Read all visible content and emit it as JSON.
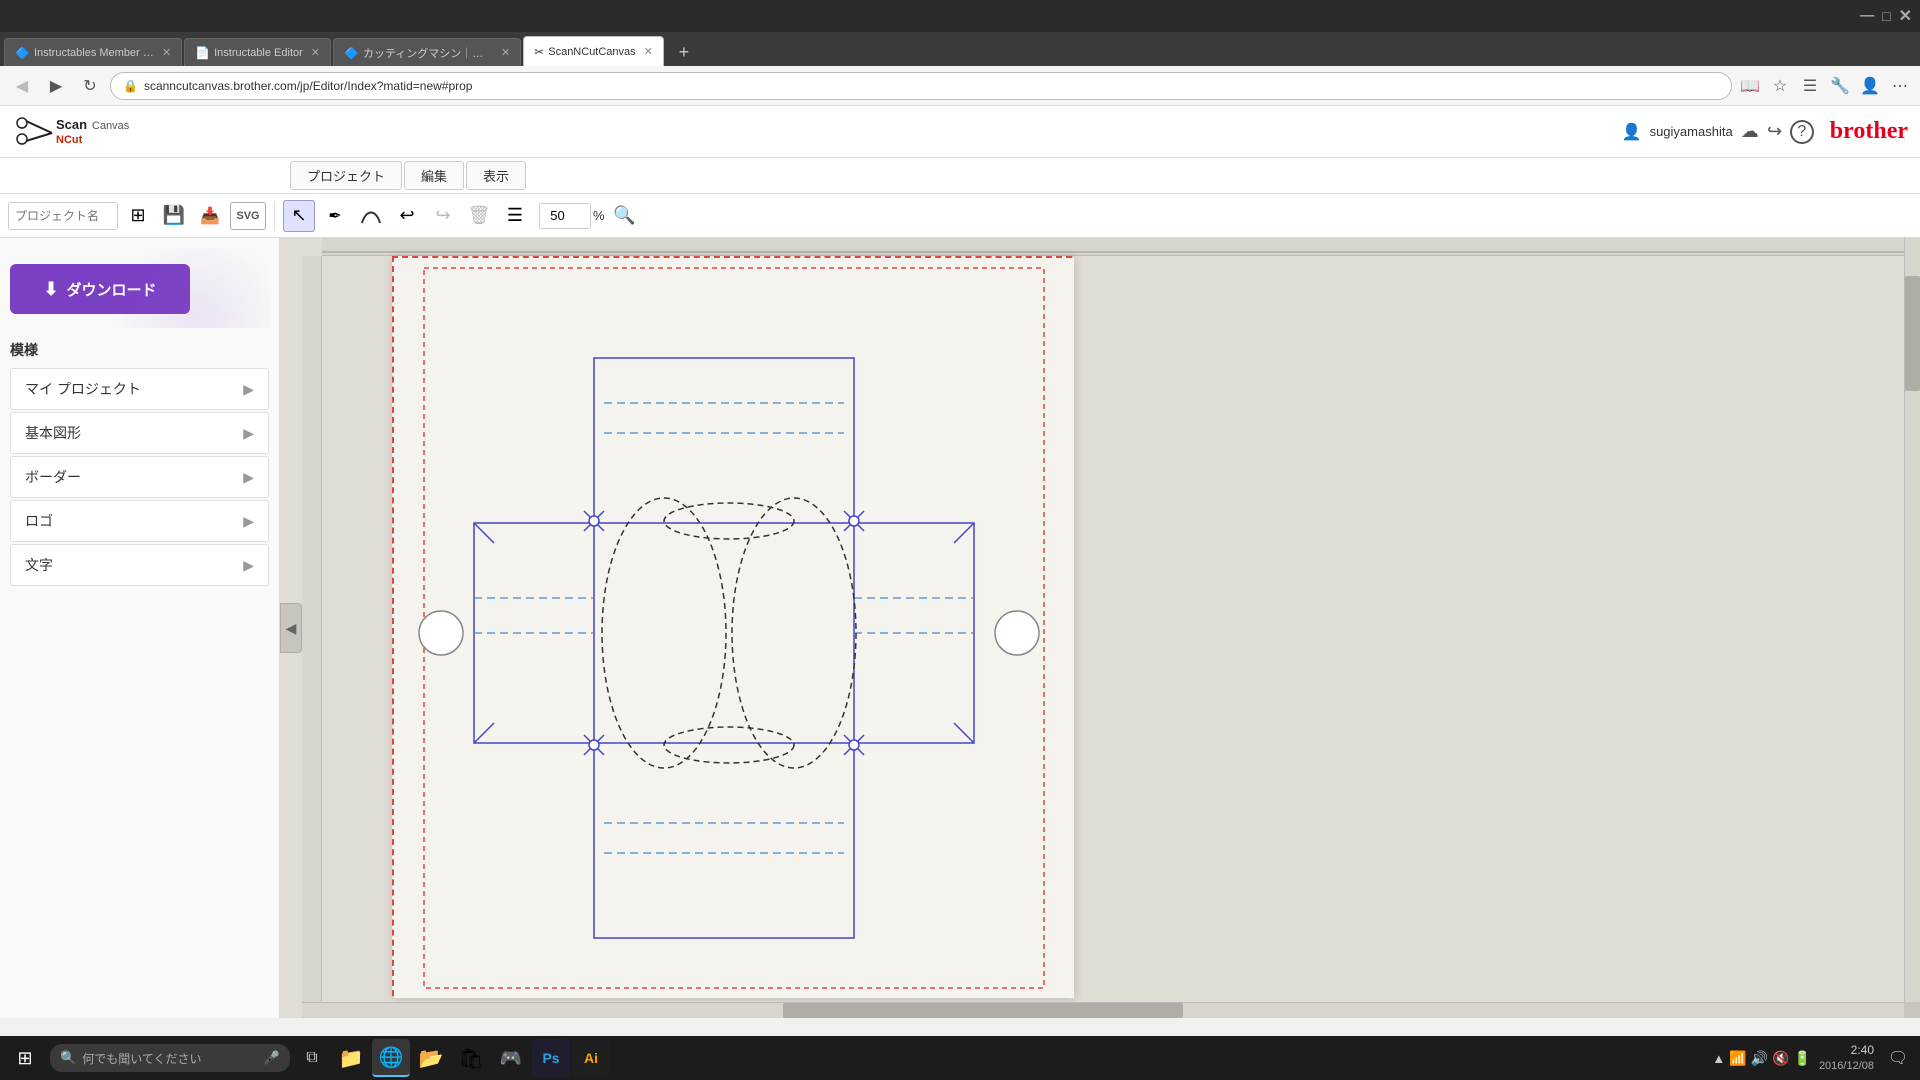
{
  "browser": {
    "tabs": [
      {
        "id": 1,
        "label": "Instructables Member : cho...",
        "favicon": "🔷",
        "active": false
      },
      {
        "id": 2,
        "label": "Instructable Editor",
        "favicon": "📄",
        "active": false
      },
      {
        "id": 3,
        "label": "カッティングマシン｜家庭用ミシ...",
        "favicon": "🔷",
        "active": false
      },
      {
        "id": 4,
        "label": "ScanNCutCanvas",
        "favicon": "✂",
        "active": true
      }
    ],
    "address": "scanncutcanvas.brother.com/jp/Editor/Index?matid=new#prop",
    "new_tab_label": "+"
  },
  "app": {
    "logo": "ScanNCut Canvas",
    "logo_scan": "Scan",
    "logo_cut": "NCut",
    "logo_canvas": "Canvas",
    "user": "sugiyamashita",
    "brother_brand": "brother"
  },
  "menu": {
    "items": [
      "プロジェクト",
      "編集",
      "表示"
    ]
  },
  "toolbar": {
    "project_name_placeholder": "プロジェクト名",
    "zoom_value": "50",
    "zoom_unit": "%"
  },
  "sidebar": {
    "download_label": "ダウンロード",
    "section_label": "模様",
    "menu_items": [
      {
        "label": "マイ プロジェクト"
      },
      {
        "label": "基本図形"
      },
      {
        "label": "ボーダー"
      },
      {
        "label": "ロゴ"
      },
      {
        "label": "文字"
      }
    ]
  },
  "taskbar": {
    "search_placeholder": "何でも聞いてください",
    "clock": "2:40",
    "date": "2016/12/08",
    "start_icon": "⊞",
    "search_icon": "🔍",
    "mic_icon": "🎤"
  },
  "icons": {
    "download_icon": "⬇",
    "select_icon": "↖",
    "pen_icon": "✏",
    "curve_icon": "~",
    "undo_icon": "↩",
    "redo_icon": "↪",
    "delete_icon": "🗑",
    "list_icon": "☰",
    "search_icon": "🔍",
    "chevron_right": "▶",
    "chevron_left": "◀",
    "user_icon": "👤",
    "save_icon": "💾",
    "export_icon": "↗",
    "help_icon": "?"
  }
}
